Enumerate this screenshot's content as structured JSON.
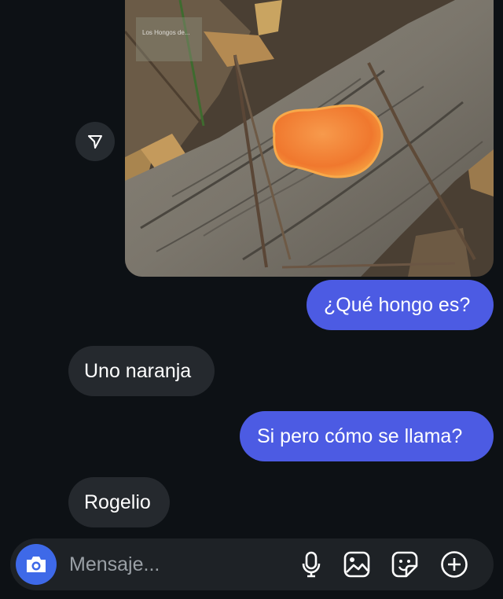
{
  "thread": {
    "image": {
      "kind": "photo",
      "watermark": "Los Hongos de..."
    },
    "messages": [
      {
        "id": "msg1",
        "direction": "outgoing",
        "text": "¿Qué hongo es?"
      },
      {
        "id": "msg2",
        "direction": "incoming",
        "text": "Uno naranja"
      },
      {
        "id": "msg3",
        "direction": "outgoing",
        "text": "Si pero cómo se llama?"
      },
      {
        "id": "msg4",
        "direction": "incoming",
        "text": "Rogelio"
      }
    ]
  },
  "composer": {
    "placeholder": "Mensaje...",
    "icons": [
      "camera-icon",
      "microphone-icon",
      "gallery-icon",
      "sticker-icon",
      "add-icon"
    ]
  },
  "colors": {
    "background": "#0d1115",
    "outgoing_bubble": "#4c5be3",
    "incoming_bubble": "#25292e",
    "camera_button": "#3e69e8",
    "composer": "#1e2226"
  }
}
